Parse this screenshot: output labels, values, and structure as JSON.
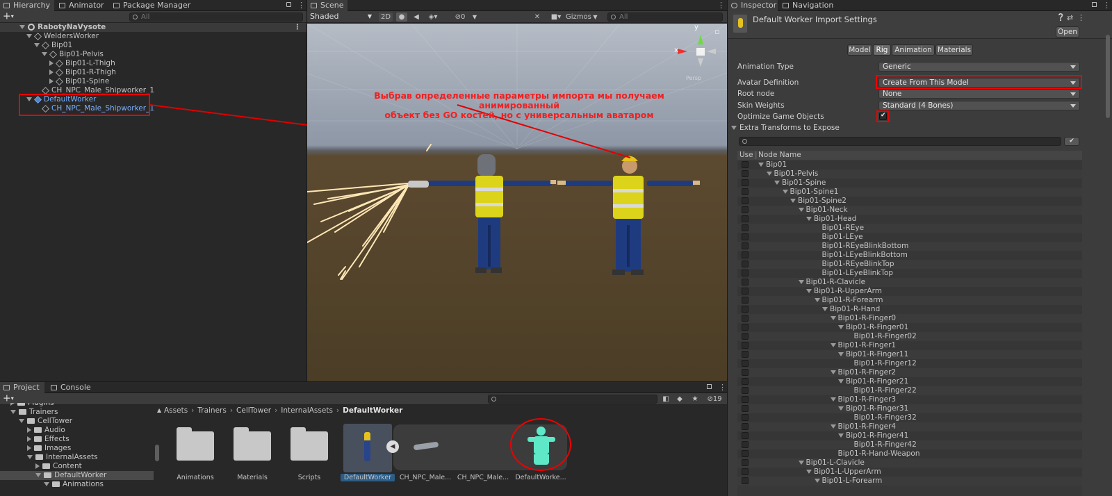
{
  "hierarchy": {
    "tabs": [
      {
        "label": "Hierarchy"
      },
      {
        "label": "Animator"
      },
      {
        "label": "Package Manager"
      }
    ],
    "search_placeholder": "All",
    "scene_name": "RabotyNaVysote",
    "rows": [
      {
        "label": "WeldersWorker",
        "depth": 1,
        "arrow": "down",
        "icon": "cube",
        "color": "#c4c4c4"
      },
      {
        "label": "Bip01",
        "depth": 2,
        "arrow": "down",
        "icon": "cube",
        "color": "#c4c4c4"
      },
      {
        "label": "Bip01-Pelvis",
        "depth": 3,
        "arrow": "down",
        "icon": "cube",
        "color": "#c4c4c4"
      },
      {
        "label": "Bip01-L-Thigh",
        "depth": 4,
        "arrow": "right",
        "icon": "cube",
        "color": "#c4c4c4"
      },
      {
        "label": "Bip01-R-Thigh",
        "depth": 4,
        "arrow": "right",
        "icon": "cube",
        "color": "#c4c4c4"
      },
      {
        "label": "Bip01-Spine",
        "depth": 4,
        "arrow": "right",
        "icon": "cube",
        "color": "#c4c4c4"
      },
      {
        "label": "CH_NPC_Male_Shipworker_1",
        "depth": 2,
        "arrow": "none",
        "icon": "cube",
        "color": "#c4c4c4"
      },
      {
        "label": "DefaultWorker",
        "depth": 1,
        "arrow": "down",
        "icon": "prefab",
        "color": "#7cb0ff"
      },
      {
        "label": "CH_NPC_Male_Shipworker_1",
        "depth": 2,
        "arrow": "none",
        "icon": "cube",
        "color": "#7cb0ff"
      }
    ]
  },
  "scene": {
    "tab_label": "Scene",
    "shading_mode": "Shaded",
    "mode_2d_label": "2D",
    "hidden_count": "0",
    "gizmos_label": "Gizmos",
    "search_placeholder": "All",
    "axis_x_label": "x",
    "axis_y_label": "y",
    "persp_label": "Persp",
    "annotation_line1": "Выбрав определенные параметры импорта мы получаем анимированный",
    "annotation_line2": "объект без GO костей, но с универсальным аватаром"
  },
  "project": {
    "tabs": [
      {
        "label": "Project"
      },
      {
        "label": "Console"
      }
    ],
    "hidden_count": "19",
    "tree": [
      {
        "label": "Plugins",
        "depth": 1,
        "arrow": "right"
      },
      {
        "label": "Trainers",
        "depth": 1,
        "arrow": "down"
      },
      {
        "label": "CellTower",
        "depth": 2,
        "arrow": "down"
      },
      {
        "label": "Audio",
        "depth": 3,
        "arrow": "right"
      },
      {
        "label": "Effects",
        "depth": 3,
        "arrow": "right"
      },
      {
        "label": "Images",
        "depth": 3,
        "arrow": "right"
      },
      {
        "label": "InternalAssets",
        "depth": 3,
        "arrow": "down"
      },
      {
        "label": "Content",
        "depth": 4,
        "arrow": "right"
      },
      {
        "label": "DefaultWorker",
        "depth": 4,
        "arrow": "down",
        "selected": true
      },
      {
        "label": "Animations",
        "depth": 5,
        "arrow": "down"
      }
    ],
    "breadcrumb": [
      {
        "label": "Assets"
      },
      {
        "label": "Trainers"
      },
      {
        "label": "CellTower"
      },
      {
        "label": "InternalAssets"
      },
      {
        "label": "DefaultWorker",
        "current": true
      }
    ],
    "assets": [
      {
        "label": "Animations",
        "kind": "folder"
      },
      {
        "label": "Materials",
        "kind": "folder"
      },
      {
        "label": "Scripts",
        "kind": "folder"
      },
      {
        "label": "DefaultWorker",
        "kind": "model"
      },
      {
        "label": "CH_NPC_Male...",
        "kind": "mesh"
      },
      {
        "label": "CH_NPC_Male...",
        "kind": "mesh2"
      },
      {
        "label": "DefaultWorke...",
        "kind": "avatar"
      }
    ]
  },
  "inspector": {
    "tabs": [
      {
        "label": "Inspector"
      },
      {
        "label": "Navigation"
      }
    ],
    "title": "Default Worker Import Settings",
    "open_button": "Open",
    "import_tabs": [
      {
        "label": "Model"
      },
      {
        "label": "Rig",
        "active": true
      },
      {
        "label": "Animation"
      },
      {
        "label": "Materials"
      }
    ],
    "animation_type_label": "Animation Type",
    "animation_type_value": "Generic",
    "avatar_definition_label": "Avatar Definition",
    "avatar_definition_value": "Create From This Model",
    "root_node_label": "Root node",
    "root_node_value": "None",
    "skin_weights_label": "Skin Weights",
    "skin_weights_value": "Standard (4 Bones)",
    "optimize_label": "Optimize Game Objects",
    "optimize_checked": true,
    "extra_transforms_label": "Extra Transforms to Expose",
    "col_use": "Use",
    "col_node": "Node Name",
    "nodes": [
      {
        "label": "Bip01",
        "depth": 0,
        "arrow": true
      },
      {
        "label": "Bip01-Pelvis",
        "depth": 1,
        "arrow": true
      },
      {
        "label": "Bip01-Spine",
        "depth": 2,
        "arrow": true
      },
      {
        "label": "Bip01-Spine1",
        "depth": 3,
        "arrow": true
      },
      {
        "label": "Bip01-Spine2",
        "depth": 4,
        "arrow": true
      },
      {
        "label": "Bip01-Neck",
        "depth": 5,
        "arrow": true
      },
      {
        "label": "Bip01-Head",
        "depth": 6,
        "arrow": true
      },
      {
        "label": "Bip01-REye",
        "depth": 7,
        "arrow": false
      },
      {
        "label": "Bip01-LEye",
        "depth": 7,
        "arrow": false
      },
      {
        "label": "Bip01-REyeBlinkBottom",
        "depth": 7,
        "arrow": false
      },
      {
        "label": "Bip01-LEyeBlinkBottom",
        "depth": 7,
        "arrow": false
      },
      {
        "label": "Bip01-REyeBlinkTop",
        "depth": 7,
        "arrow": false
      },
      {
        "label": "Bip01-LEyeBlinkTop",
        "depth": 7,
        "arrow": false
      },
      {
        "label": "Bip01-R-Clavicle",
        "depth": 5,
        "arrow": true
      },
      {
        "label": "Bip01-R-UpperArm",
        "depth": 6,
        "arrow": true
      },
      {
        "label": "Bip01-R-Forearm",
        "depth": 7,
        "arrow": true
      },
      {
        "label": "Bip01-R-Hand",
        "depth": 8,
        "arrow": true
      },
      {
        "label": "Bip01-R-Finger0",
        "depth": 9,
        "arrow": true
      },
      {
        "label": "Bip01-R-Finger01",
        "depth": 10,
        "arrow": true
      },
      {
        "label": "Bip01-R-Finger02",
        "depth": 11,
        "arrow": false
      },
      {
        "label": "Bip01-R-Finger1",
        "depth": 9,
        "arrow": true
      },
      {
        "label": "Bip01-R-Finger11",
        "depth": 10,
        "arrow": true
      },
      {
        "label": "Bip01-R-Finger12",
        "depth": 11,
        "arrow": false
      },
      {
        "label": "Bip01-R-Finger2",
        "depth": 9,
        "arrow": true
      },
      {
        "label": "Bip01-R-Finger21",
        "depth": 10,
        "arrow": true
      },
      {
        "label": "Bip01-R-Finger22",
        "depth": 11,
        "arrow": false
      },
      {
        "label": "Bip01-R-Finger3",
        "depth": 9,
        "arrow": true
      },
      {
        "label": "Bip01-R-Finger31",
        "depth": 10,
        "arrow": true
      },
      {
        "label": "Bip01-R-Finger32",
        "depth": 11,
        "arrow": false
      },
      {
        "label": "Bip01-R-Finger4",
        "depth": 9,
        "arrow": true
      },
      {
        "label": "Bip01-R-Finger41",
        "depth": 10,
        "arrow": true
      },
      {
        "label": "Bip01-R-Finger42",
        "depth": 11,
        "arrow": false
      },
      {
        "label": "Bip01-R-Hand-Weapon",
        "depth": 9,
        "arrow": false
      },
      {
        "label": "Bip01-L-Clavicle",
        "depth": 5,
        "arrow": true
      },
      {
        "label": "Bip01-L-UpperArm",
        "depth": 6,
        "arrow": true
      },
      {
        "label": "Bip01-L-Forearm",
        "depth": 7,
        "arrow": true
      }
    ]
  },
  "colors": {
    "selection": "#2c5d87",
    "highlight_red": "#e00000",
    "avatar_icon": "#5ee8c8",
    "link_blue": "#7cb0ff"
  }
}
